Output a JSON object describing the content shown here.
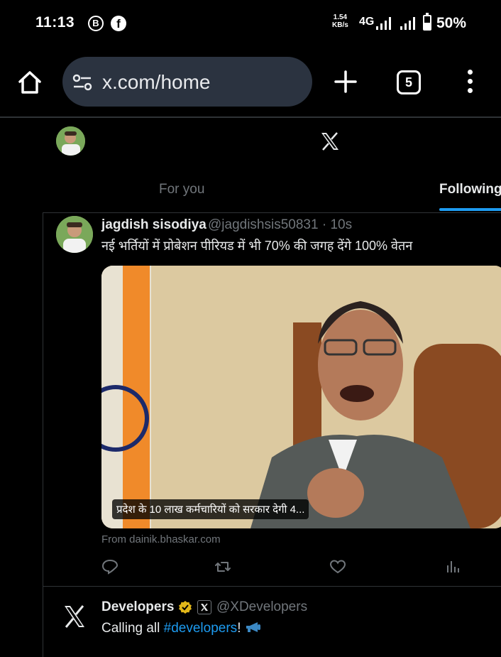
{
  "status_bar": {
    "time": "11:13",
    "net_speed_value": "1.54",
    "net_speed_unit": "KB/s",
    "network_type": "4G",
    "battery": "50%",
    "battery_level": 0.5,
    "app_icons": [
      "beeper-icon",
      "facebook-icon"
    ]
  },
  "browser": {
    "url": "x.com/home",
    "tab_count": "5",
    "icons": [
      "home-icon",
      "site-settings-icon",
      "plus-icon",
      "tabs-icon",
      "more-vert-icon"
    ]
  },
  "x_header": {
    "tabs": [
      {
        "label": "For you",
        "active": false
      },
      {
        "label": "Following",
        "active": true
      }
    ],
    "accent": "#1d9bf0"
  },
  "tweets": [
    {
      "name": "jagdish sisodiya",
      "handle_time": "@jagdishsis50831 · 10s",
      "text": "नई भर्तियों में प्रोबेशन पीरियड में भी 70% की जगह देंगे 100% वेतन",
      "card": {
        "caption": "प्रदेश के 10 लाख कर्मचारियों को सरकार देगी 4...",
        "from": "From dainik.bhaskar.com"
      },
      "actions": [
        "reply-icon",
        "retweet-icon",
        "like-icon",
        "views-icon"
      ]
    },
    {
      "name": "Developers",
      "handle": "@XDevelopers",
      "text_prefix": "Calling all ",
      "hashtag": "#developers",
      "text_suffix": "!",
      "badges": [
        "verified-gold-icon",
        "x-affiliate-icon"
      ],
      "emoji": "megaphone-icon"
    }
  ]
}
